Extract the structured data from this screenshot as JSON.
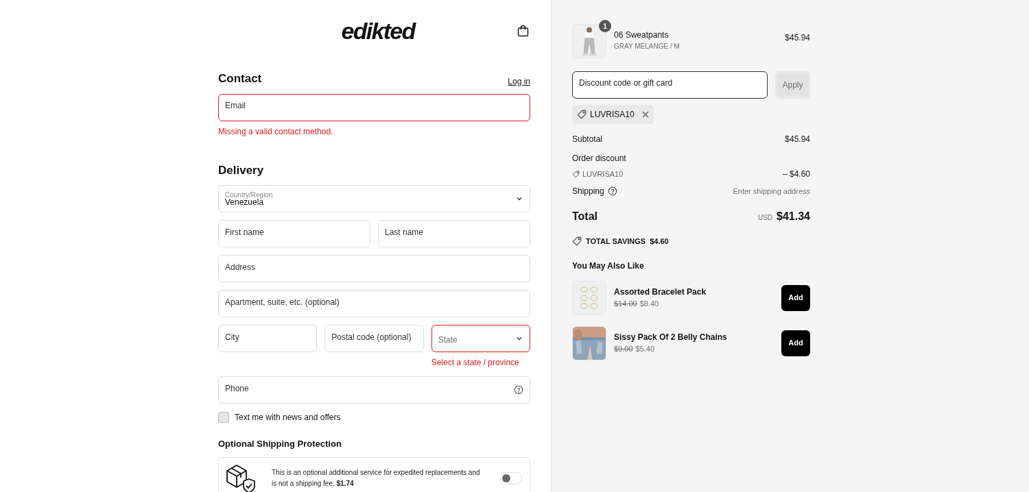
{
  "header": {
    "logo": "edikted"
  },
  "contact": {
    "title": "Contact",
    "login": "Log in",
    "email": {
      "placeholder": "Email",
      "error": true
    },
    "error_message": "Missing a valid contact method."
  },
  "delivery": {
    "title": "Delivery",
    "country": {
      "label": "Country/Region",
      "value": "Venezuela"
    },
    "rows": [
      [
        {
          "kind": "input",
          "placeholder": "First name",
          "error": false
        },
        {
          "kind": "input",
          "placeholder": "Last name",
          "error": false
        }
      ],
      [
        {
          "kind": "input",
          "placeholder": "Address",
          "error": false
        }
      ],
      [
        {
          "kind": "input",
          "placeholder": "Apartment, suite, etc. (optional)",
          "error": false
        }
      ],
      [
        {
          "kind": "input",
          "placeholder": "City",
          "error": false
        },
        {
          "kind": "input",
          "placeholder": "Postal code (optional)",
          "error": false
        },
        {
          "kind": "select",
          "placeholder": "State",
          "error": true,
          "error_message": "Select a state / province"
        }
      ]
    ],
    "phone": {
      "placeholder": "Phone"
    },
    "sms": {
      "label": "Text me with news and offers",
      "checked": false
    }
  },
  "protection": {
    "title": "Optional Shipping Protection",
    "text": "This is an optional additional service for expedited replacements and is not a shipping fee. **$1.74**",
    "on": false
  },
  "cart": {
    "items": [
      {
        "name": "06 Sweatpants",
        "variant": "GRAY MELANGE / M",
        "price": "$45.94",
        "quantity": "1"
      }
    ],
    "discount": {
      "placeholder": "Discount code or gift card",
      "button": "Apply"
    },
    "applied_code": "LUVRISA10",
    "subtotal": {
      "label": "Subtotal",
      "value": "$45.94"
    },
    "order_discount": {
      "label": "Order discount",
      "code": "LUVRISA10",
      "value": "– $4.60"
    },
    "shipping": {
      "label": "Shipping",
      "value": "Enter shipping address"
    },
    "total": {
      "label": "Total",
      "currency": "USD",
      "value": "$41.34"
    },
    "savings": {
      "label": "TOTAL SAVINGS",
      "value": "$4.60"
    }
  },
  "recommendations": {
    "title": "You May Also Like",
    "items": [
      {
        "name": "Assorted Bracelet Pack",
        "old_price": "$14.00",
        "price": "$8.40",
        "button": "Add"
      },
      {
        "name": "Sissy Pack Of 2 Belly Chains",
        "old_price": "$9.00",
        "price": "$5.40",
        "button": "Add"
      }
    ]
  }
}
